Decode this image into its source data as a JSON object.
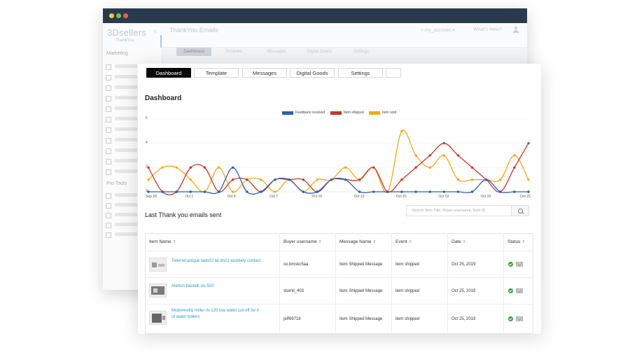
{
  "back_window": {
    "brand": "3Dsellers",
    "title": "ThankYou Emails",
    "account": "my_account",
    "whats_new": "What's New?",
    "active_sidebar": "ThankYou",
    "sidebar_heading_marketing": "Marketing",
    "sidebar_heading_pro": "Pro Tools",
    "tabs": [
      "Dashboard",
      "Template",
      "Messages",
      "Digital Goods",
      "Settings"
    ]
  },
  "tabs": [
    "Dashboard",
    "Template",
    "Messages",
    "Digital Goods",
    "Settings"
  ],
  "active_tab": "Dashboard",
  "dashboard_title": "Dashboard",
  "chart_data": {
    "type": "line",
    "x": [
      "Sep 28",
      "Sep 29",
      "Sep 30",
      "Oct 1",
      "Oct 2",
      "Oct 3",
      "Oct 4",
      "Oct 5",
      "Oct 6",
      "Oct 7",
      "Oct 8",
      "Oct 9",
      "Oct 10",
      "Oct 11",
      "Oct 12",
      "Oct 13",
      "Oct 14",
      "Oct 15",
      "Oct 16",
      "Oct 17",
      "Oct 18",
      "Oct 19",
      "Oct 20",
      "Oct 21",
      "Oct 22",
      "Oct 23",
      "Oct 24",
      "Oct 25"
    ],
    "xticks": [
      "Sep 28",
      "Oct 1",
      "Oct 4",
      "Oct 7",
      "Oct 10",
      "Oct 13",
      "Oct 16",
      "Oct 19",
      "Oct 22",
      "Oct 25"
    ],
    "yticks": [
      0,
      2,
      4,
      6
    ],
    "ylim": [
      0,
      6
    ],
    "legend_position": "top-center",
    "series": [
      {
        "name": "Feedback received",
        "color": "#2d5fb3",
        "values": [
          0,
          0,
          0,
          0,
          0,
          0,
          2,
          0,
          0,
          1,
          1,
          0,
          0,
          1,
          1,
          0,
          0,
          0,
          0,
          0,
          0,
          0,
          0,
          0,
          1,
          0,
          0,
          0
        ]
      },
      {
        "name": "Item shipped",
        "color": "#c1392b",
        "values": [
          2,
          0,
          0,
          2,
          2,
          0,
          1,
          1,
          0,
          1,
          1,
          1,
          0,
          1,
          1,
          1,
          2,
          0,
          1,
          2,
          3,
          4,
          3,
          2,
          1,
          0,
          2,
          4
        ]
      },
      {
        "name": "Item sold",
        "color": "#eeaa1c",
        "values": [
          1,
          2,
          2,
          1,
          0,
          2,
          0,
          1,
          1,
          0,
          1,
          0,
          1,
          1,
          2,
          1,
          2,
          0,
          5,
          3,
          2,
          3,
          1,
          1,
          1,
          1,
          3,
          1
        ]
      }
    ]
  },
  "table_section": {
    "title": "Last Thank you emails sent",
    "search_placeholder": "Search Item Title, Buyer username, Item ID",
    "columns": [
      "Item Name",
      "Buyer username",
      "Message Name",
      "Event",
      "Date",
      "Status"
    ],
    "rows": [
      {
        "item_line1": "Telemecanique ladn22 lal dn22 auxiliary contact",
        "item_line2": "",
        "buyer": "so.bmskc5aa",
        "message": "Item Shipped Message",
        "event": "item shipped",
        "date": "Oct 25, 2019"
      },
      {
        "item_line1": "Alerton bactalk vlc-550",
        "item_line2": "",
        "buyer": "stumil_403",
        "message": "Item Shipped Message",
        "event": "item shipped",
        "date": "Oct 25, 2019"
      },
      {
        "item_line1": "Mcdonnell& miller rb-120 low water cut-off for h",
        "item_line2": "ot water boilers",
        "buyer": "jeff69716",
        "message": "Item Shipped Message",
        "event": "item shipped",
        "date": "Oct 25, 2019"
      }
    ]
  },
  "colors": {
    "accent_link": "#2a9bd0",
    "active_tab": "#0a0a0a",
    "status_ok": "#2e9d3a",
    "titlebar": "#2a3a4c"
  }
}
